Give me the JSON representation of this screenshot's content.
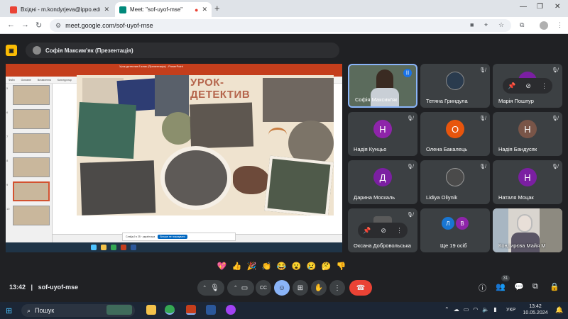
{
  "browser": {
    "tabs": [
      {
        "title": "Вхідні - m.kondyrjeva@ippo.edu.te",
        "favicon_color": "#ea4335"
      },
      {
        "title": "Meet: \"sof-uyof-mse\"",
        "favicon_color": "#00897b"
      }
    ],
    "new_tab": "+",
    "url": "meet.google.com/sof-uyof-mse"
  },
  "presenter": {
    "label": "Софія Максим'як (Презентація)"
  },
  "slide": {
    "title_line1": "УРОК-",
    "title_line2": "ДЕТЕКТИВ",
    "ppt_window_title": "Урок-детектив 8 клас (Презентація) - PowerPoint",
    "ribbon_tabs": [
      "Файл",
      "Основне",
      "Вставлення",
      "Конструктор",
      "Переходи",
      "Анімація",
      "Слайд-шоу",
      "Рецензування",
      "Подання",
      "Запис",
      "Довідка"
    ],
    "thumb_numbers": [
      "5",
      "6",
      "7",
      "8",
      "9",
      "10"
    ],
    "notice_text": "Слайд 9 з 25 · українська",
    "notice_button": "Більше не показувати"
  },
  "participants": [
    {
      "name": "Софія Максим'як",
      "type": "video",
      "bg": "#5b6b5c",
      "speaking": true
    },
    {
      "name": "Тетяна Гриндула",
      "type": "photo",
      "bg": "#2a3b4e"
    },
    {
      "name": "Марія Пошпур",
      "type": "avatar",
      "initial": "М",
      "color": "#7b1fa2",
      "pinned_menu": true
    },
    {
      "name": "Надія Кунцьо",
      "type": "avatar",
      "initial": "Н",
      "color": "#8e24aa"
    },
    {
      "name": "Олена Бакалець",
      "type": "avatar",
      "initial": "О",
      "color": "#e8550d"
    },
    {
      "name": "Надія Бандусяк",
      "type": "avatar",
      "initial": "Н",
      "color": "#795548"
    },
    {
      "name": "Дарина Москаль",
      "type": "avatar",
      "initial": "Д",
      "color": "#7b1fa2"
    },
    {
      "name": "Lidiya Oliynik",
      "type": "photo",
      "bg": "#4a4a4a"
    },
    {
      "name": "Наталя Моцак",
      "type": "avatar",
      "initial": "Н",
      "color": "#7b1fa2"
    },
    {
      "name": "Оксана Добровольська",
      "type": "photo",
      "bg": "#5a5a5a",
      "pinned_menu": true
    },
    {
      "name": "Ще 19 осіб",
      "type": "more",
      "initials": [
        "Л",
        "В"
      ],
      "colors": [
        "#1976d2",
        "#8e24aa"
      ]
    },
    {
      "name": "Кондирєва Майя М",
      "type": "video",
      "bg": "#d9d5cf"
    }
  ],
  "reactions": [
    "💖",
    "👍",
    "🎉",
    "👏",
    "😂",
    "😮",
    "😢",
    "🤔",
    "👎"
  ],
  "meeting": {
    "time": "13:42",
    "separator": "|",
    "code": "sof-uyof-mse",
    "participant_count": "31"
  },
  "taskbar": {
    "search_placeholder": "Пошук",
    "language": "УКР",
    "time": "13:42",
    "date": "10.05.2024"
  },
  "colors": {
    "meet_bg": "#202124",
    "tile_bg": "#3c4043",
    "leave_red": "#ea4335",
    "active_blue": "#8ab4f8"
  }
}
